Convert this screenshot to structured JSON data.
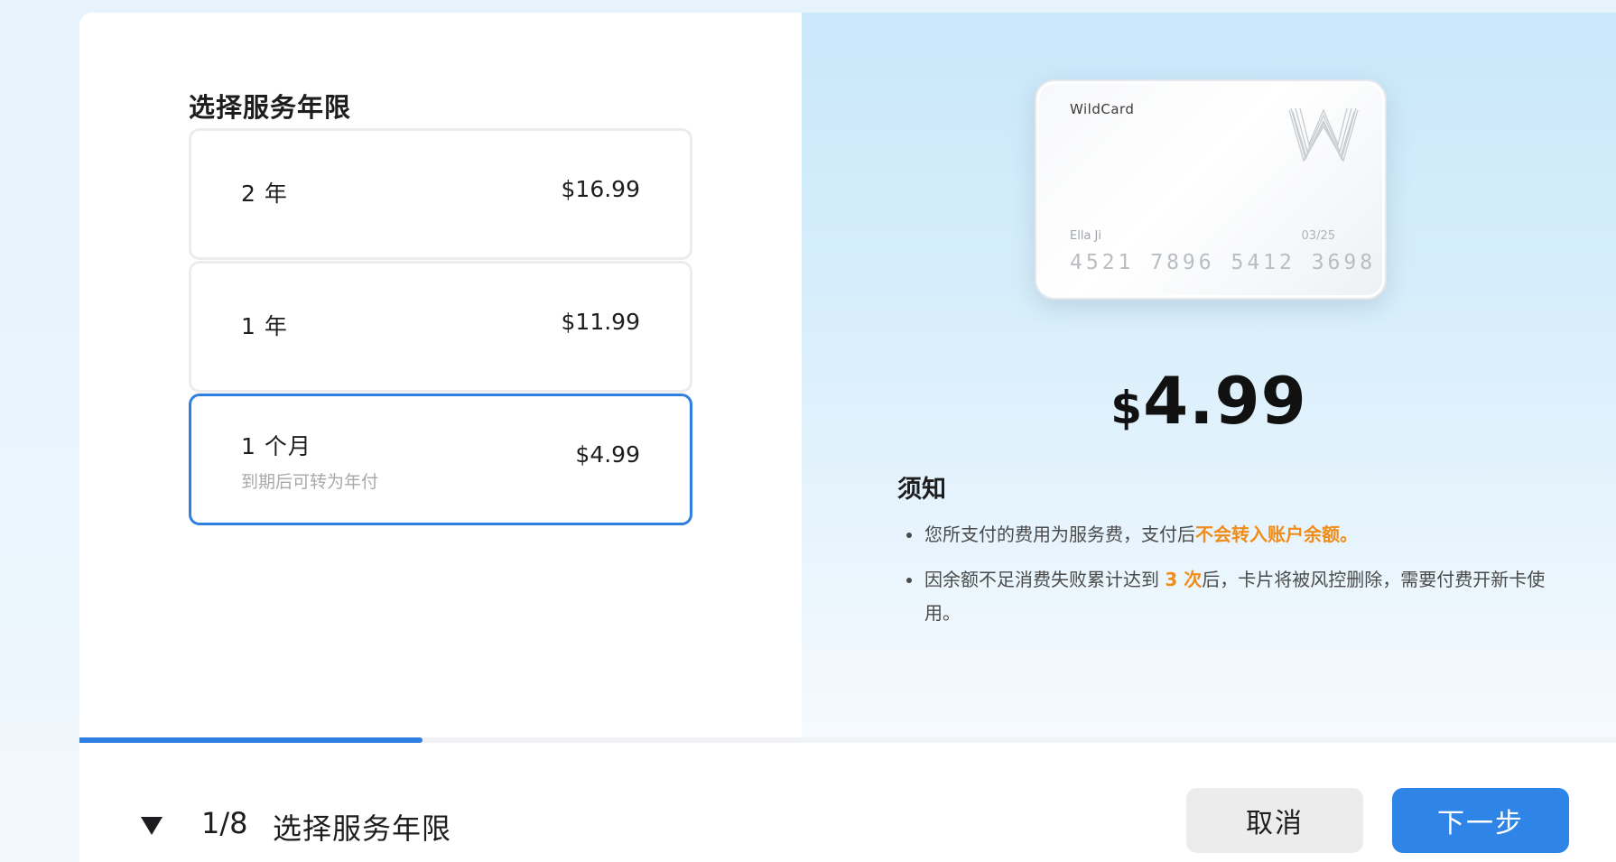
{
  "left": {
    "title": "选择服务年限",
    "options": [
      {
        "label": "2 年",
        "price": "$16.99",
        "sub": "",
        "selected": false
      },
      {
        "label": "1 年",
        "price": "$11.99",
        "sub": "",
        "selected": false
      },
      {
        "label": "1 个月",
        "price": "$4.99",
        "sub": "到期后可转为年付",
        "selected": true
      }
    ]
  },
  "card": {
    "brand": "WildCard",
    "logo_icon": "wildcard-w-logo-icon",
    "holder": "Ella Ji",
    "expiry": "03/25",
    "number": "4521 7896 5412 3698"
  },
  "summary": {
    "currency": "$",
    "amount": "4.99"
  },
  "notice": {
    "title": "须知",
    "item1_text": "您所支付的费用为服务费，支付后",
    "item1_highlight": "不会转入账户余额。",
    "item2_text_a": "因余额不足消费失败累计达到 ",
    "item2_highlight": "3 次",
    "item2_text_b": "后，卡片将被风控删除，需要付费开新卡使用。"
  },
  "progress": {
    "current": 1,
    "total": 8,
    "fraction": 0.223
  },
  "footer": {
    "collapse_icon": "caret-down-icon",
    "step_count": "1/8",
    "step_title": "选择服务年限",
    "cancel_label": "取消",
    "next_label": "下一步"
  },
  "colors": {
    "accent": "#2f7fe2",
    "highlight": "#f08c1a"
  }
}
